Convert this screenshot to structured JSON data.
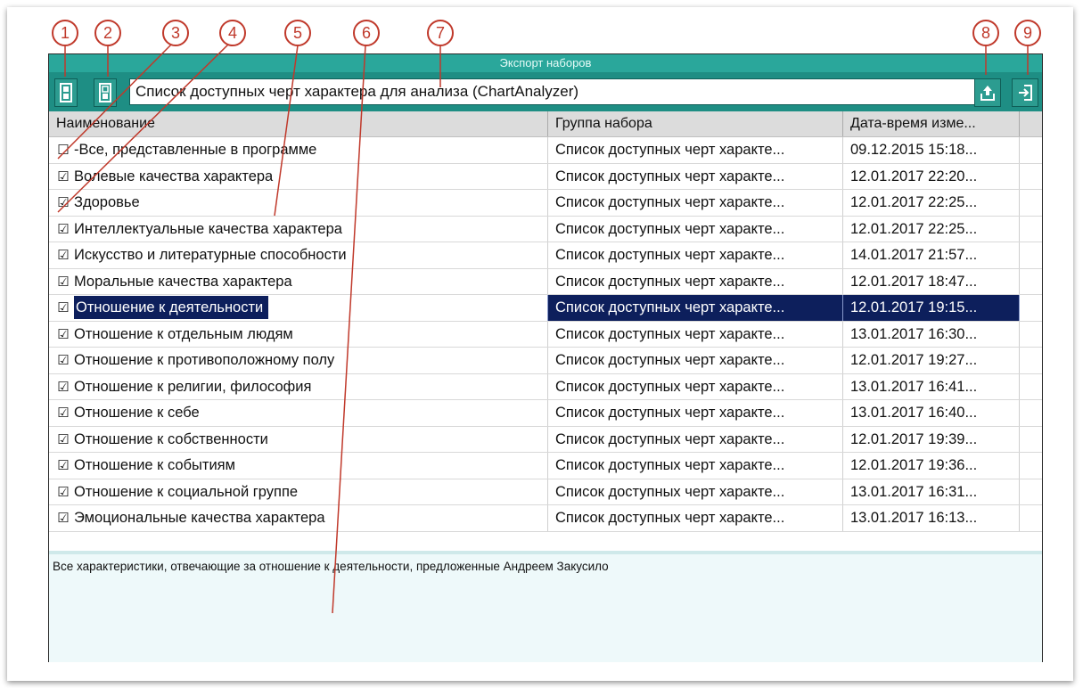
{
  "window": {
    "title": "Экспорт наборов"
  },
  "toolbar": {
    "combo_value": "Список доступных черт характера для анализа (ChartAnalyzer)"
  },
  "columns": [
    "Наименование",
    "Группа набора",
    "Дата-время изме..."
  ],
  "rows": [
    {
      "checked": false,
      "name": "-Все, представленные в программе",
      "group": "Список доступных черт характе...",
      "date": "09.12.2015 15:18..."
    },
    {
      "checked": true,
      "name": "Волевые качества характера",
      "group": "Список доступных черт характе...",
      "date": "12.01.2017 22:20..."
    },
    {
      "checked": true,
      "name": "Здоровье",
      "group": "Список доступных черт характе...",
      "date": "12.01.2017 22:25..."
    },
    {
      "checked": true,
      "name": "Интеллектуальные качества характера",
      "group": "Список доступных черт характе...",
      "date": "12.01.2017 22:25..."
    },
    {
      "checked": true,
      "name": "Искусство и литературные способности",
      "group": "Список доступных черт характе...",
      "date": "14.01.2017 21:57..."
    },
    {
      "checked": true,
      "name": "Моральные качества характера",
      "group": "Список доступных черт характе...",
      "date": "12.01.2017 18:47..."
    },
    {
      "checked": true,
      "name": "Отношение к деятельности",
      "group": "Список доступных черт характе...",
      "date": "12.01.2017 19:15...",
      "selected": true
    },
    {
      "checked": true,
      "name": "Отношение к отдельным людям",
      "group": "Список доступных черт характе...",
      "date": "13.01.2017 16:30..."
    },
    {
      "checked": true,
      "name": "Отношение к противоположному полу",
      "group": "Список доступных черт характе...",
      "date": "12.01.2017 19:27..."
    },
    {
      "checked": true,
      "name": "Отношение к религии, философия",
      "group": "Список доступных черт характе...",
      "date": "13.01.2017 16:41..."
    },
    {
      "checked": true,
      "name": "Отношение к себе",
      "group": "Список доступных черт характе...",
      "date": "13.01.2017 16:40..."
    },
    {
      "checked": true,
      "name": "Отношение к собственности",
      "group": "Список доступных черт характе...",
      "date": "12.01.2017 19:39..."
    },
    {
      "checked": true,
      "name": "Отношение к событиям",
      "group": "Список доступных черт характе...",
      "date": "12.01.2017 19:36..."
    },
    {
      "checked": true,
      "name": "Отношение к социальной группе",
      "group": "Список доступных черт характе...",
      "date": "13.01.2017 16:31..."
    },
    {
      "checked": true,
      "name": "Эмоциональные качества характера",
      "group": "Список доступных черт характе...",
      "date": "13.01.2017 16:13..."
    }
  ],
  "description": "Все характеристики, отвечающие за отношение к деятельности, предложенные Андреем Закусило",
  "callouts": [
    "1",
    "2",
    "3",
    "4",
    "5",
    "6",
    "7",
    "8",
    "9"
  ],
  "colors": {
    "accent": "#2aa79b",
    "toolbar": "#1e8e84",
    "selection": "#0d1f5c",
    "callout": "#c0392b"
  },
  "icons": {
    "check_all": "expand-all-icon",
    "uncheck_all": "collapse-all-icon",
    "export": "export-icon",
    "exit": "exit-icon"
  }
}
